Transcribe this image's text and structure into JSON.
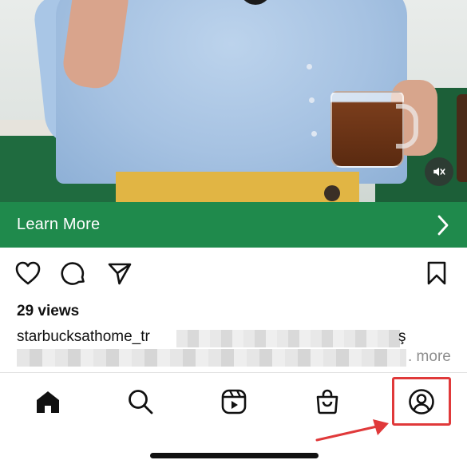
{
  "post": {
    "cta_label": "Learn More",
    "views": "29 views",
    "username": "starbucksathome_tr",
    "caption_visible_tail": "ş",
    "more_label": "... more",
    "more_text": ". more"
  },
  "colors": {
    "cta_green": "#1f8a4c",
    "highlight_red": "#e0393a"
  },
  "icons": {
    "media": [
      "mute-icon"
    ],
    "actions": [
      "heart-icon",
      "comment-icon",
      "share-icon",
      "bookmark-icon"
    ],
    "tabbar": [
      "home-icon",
      "search-icon",
      "reels-icon",
      "shop-icon",
      "profile-icon"
    ]
  }
}
